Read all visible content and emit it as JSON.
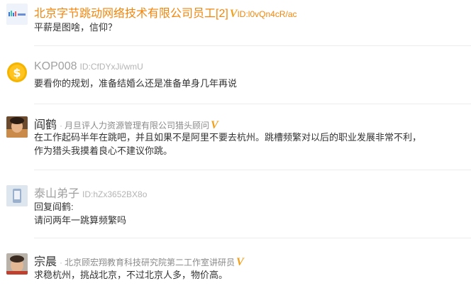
{
  "posts": [
    {
      "name": "北京字节跳动网络技术有限公司员工[2]",
      "verified_mark": "V",
      "uid": "ID:l0vQn4cR/ac",
      "text": [
        "平薪是图啥，信仰？"
      ],
      "avatar_text": "字节跳动"
    },
    {
      "name": "KOP008",
      "uid": "ID:CfDYxJi/wmU",
      "text": [
        "要看你的规划，准备结婚么还是准备单身几年再说"
      ],
      "avatar_symbol": "$"
    },
    {
      "name": "阎鹤",
      "separator": "·",
      "title": "月旦评人力资源管理有限公司猎头顾问",
      "verified_mark": "V",
      "text": [
        "在工作起码半年在跳吧，并且如果不是阿里不要去杭州。跳槽频繁对以后的职业发展非常不利，",
        "作为猎头我摸着良心不建议你跳。"
      ]
    },
    {
      "name": "泰山弟子",
      "uid": "ID:hZx3652BX8o",
      "text": [
        "回复阎鹤:",
        "请问两年一跳算频繁吗"
      ]
    },
    {
      "name": "宗晨",
      "separator": "·",
      "title": "北京顾宏翔教育科技研究院第二工作室讲研员",
      "verified_mark": "V",
      "text": [
        "求稳杭州，挑战北京，不过北京人多，物价高。"
      ]
    }
  ],
  "colors": {
    "accent_orange": "#f2860c",
    "verified_gold": "#f0a01a",
    "anon_name_gray": "#a0a0a0",
    "text": "#333333",
    "divider": "#ececec"
  }
}
